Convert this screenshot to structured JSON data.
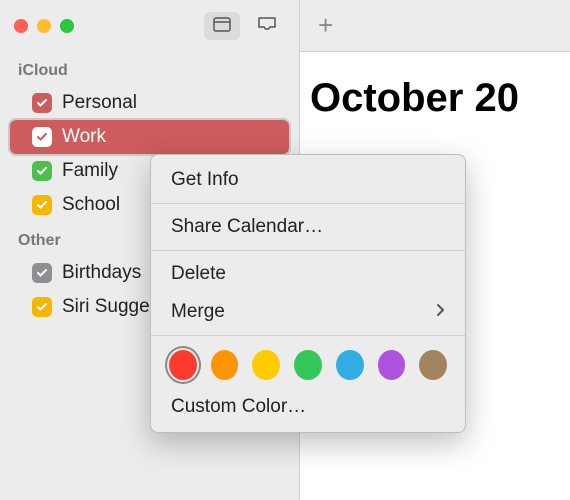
{
  "sidebar": {
    "sections": [
      {
        "title": "iCloud",
        "items": [
          {
            "label": "Personal",
            "color": "#cd5c5c",
            "selected": false
          },
          {
            "label": "Work",
            "color": "#cd5c5c",
            "selected": true
          },
          {
            "label": "Family",
            "color": "#4cbf4c",
            "selected": false
          },
          {
            "label": "School",
            "color": "#f5b700",
            "selected": false
          }
        ]
      },
      {
        "title": "Other",
        "items": [
          {
            "label": "Birthdays",
            "color": "#8e8e93",
            "selected": false
          },
          {
            "label": "Siri Suggestions",
            "color": "#f5b700",
            "selected": false
          }
        ]
      }
    ]
  },
  "main": {
    "month_title": "October 20"
  },
  "context_menu": {
    "get_info": "Get Info",
    "share": "Share Calendar…",
    "delete": "Delete",
    "merge": "Merge",
    "custom_color": "Custom Color…",
    "colors": [
      {
        "hex": "#ff3b30",
        "selected": true
      },
      {
        "hex": "#ff9500",
        "selected": false
      },
      {
        "hex": "#ffcc00",
        "selected": false
      },
      {
        "hex": "#34c759",
        "selected": false
      },
      {
        "hex": "#32ade6",
        "selected": false
      },
      {
        "hex": "#af52de",
        "selected": false
      },
      {
        "hex": "#a2845e",
        "selected": false
      }
    ]
  }
}
